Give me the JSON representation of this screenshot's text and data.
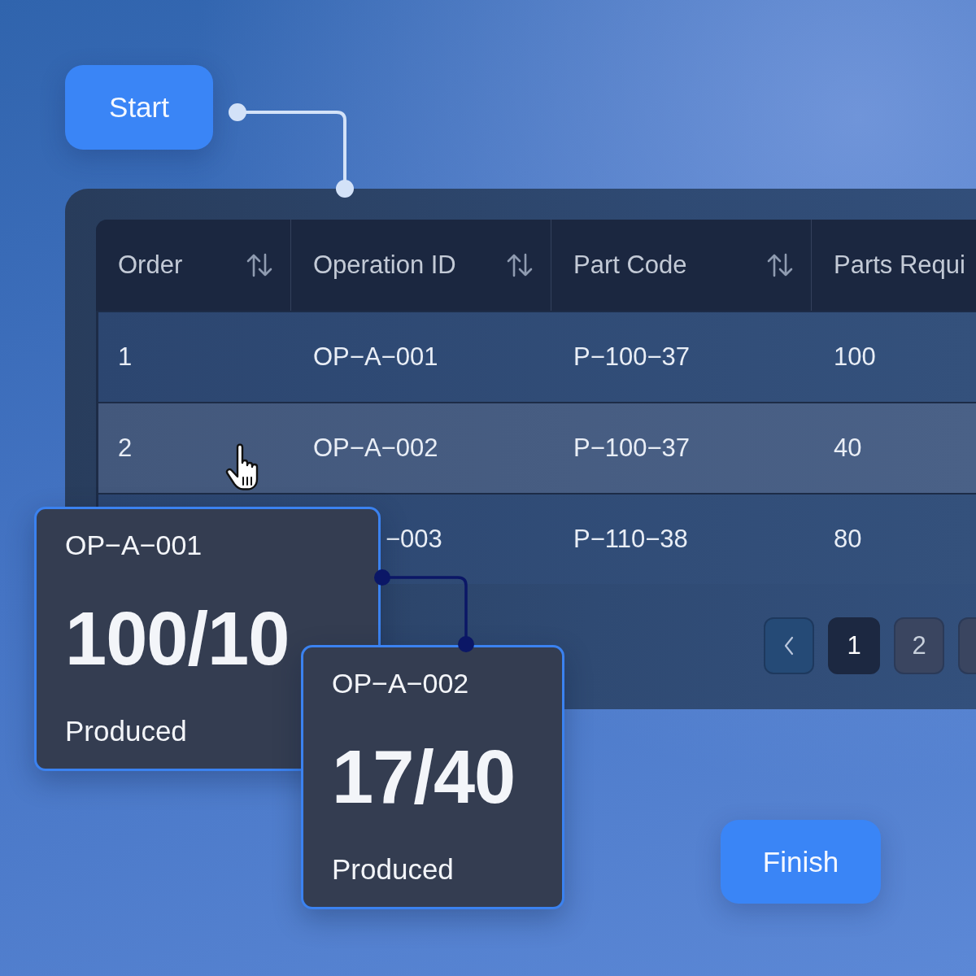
{
  "start_button": {
    "label": "Start"
  },
  "table": {
    "columns": [
      {
        "label": "Order",
        "sortable": true
      },
      {
        "label": "Operation ID",
        "sortable": true
      },
      {
        "label": "Part Code",
        "sortable": true
      },
      {
        "label": "Parts Requi",
        "sortable": false
      }
    ],
    "rows": [
      {
        "cells": [
          "1",
          "OP−A−001",
          "P−100−37",
          "100"
        ],
        "hovered": false
      },
      {
        "cells": [
          "2",
          "OP−A−002",
          "P−100−37",
          "40"
        ],
        "hovered": true
      },
      {
        "cells": [
          "",
          "−003",
          "P−110−38",
          "80"
        ],
        "hovered": false
      }
    ]
  },
  "pagination": [
    {
      "kind": "prev"
    },
    {
      "kind": "page",
      "label": "1",
      "selected": true
    },
    {
      "kind": "page",
      "label": "2",
      "selected": false
    },
    {
      "kind": "page",
      "selected": false
    }
  ],
  "cards": [
    {
      "operation": "OP−A−001",
      "count": "100/10",
      "caption": "Produced"
    },
    {
      "operation": "OP−A−002",
      "count": "17/40",
      "caption": "Produced"
    }
  ],
  "finish_button": {
    "label": "Finish"
  }
}
